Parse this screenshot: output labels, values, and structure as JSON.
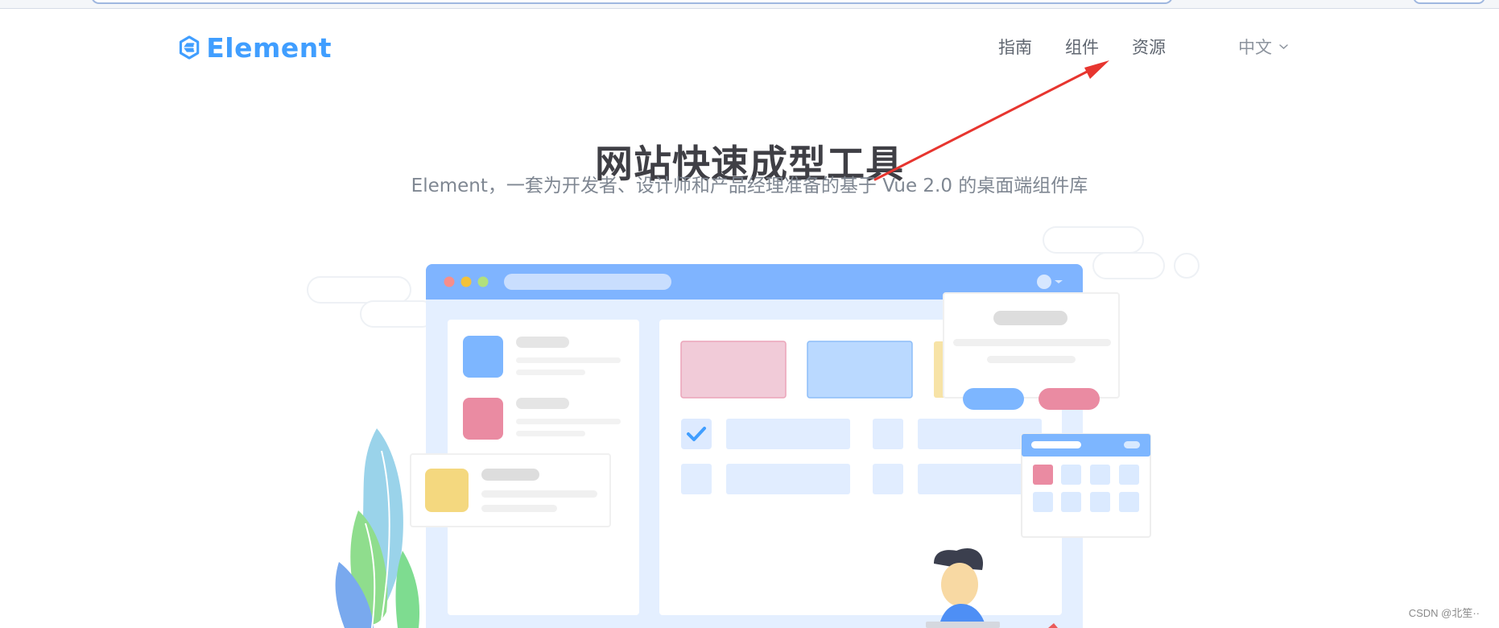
{
  "header": {
    "logo_text": "Element",
    "nav": [
      {
        "label": "指南"
      },
      {
        "label": "组件"
      },
      {
        "label": "资源"
      }
    ],
    "language": {
      "label": "中文",
      "icon": "chevron-down-icon"
    }
  },
  "hero": {
    "title": "网站快速成型工具",
    "subtitle": "Element，一套为开发者、设计师和产品经理准备的基于 Vue 2.0 的桌面端组件库"
  },
  "footer": {
    "watermark": "CSDN @北笙··"
  },
  "colors": {
    "brand": "#409eff",
    "annotation_arrow": "#e7352f"
  }
}
